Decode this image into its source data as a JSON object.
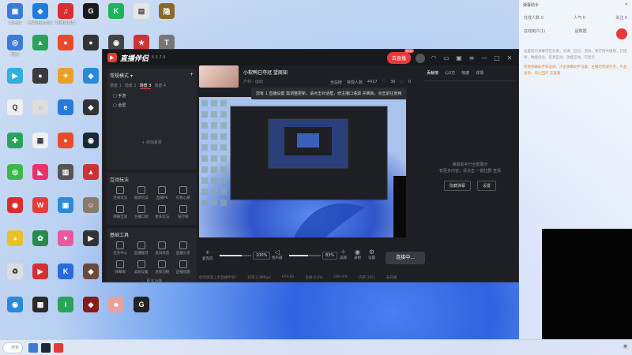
{
  "desktop": {
    "icons": [
      {
        "label": "此电脑",
        "color": "#3b7bd8",
        "glyph": "▣"
      },
      {
        "label": "腾讯电脑管家",
        "color": "#1f7ddd",
        "glyph": "◆"
      },
      {
        "label": "网易云音乐",
        "color": "#d62f2f",
        "glyph": "♫"
      },
      {
        "label": "GG",
        "color": "#1a1a1a",
        "glyph": "G"
      },
      {
        "label": "KOOK",
        "color": "#1fb45c",
        "glyph": "K"
      },
      {
        "label": "",
        "color": "#e6e6e6",
        "glyph": "▤"
      },
      {
        "label": "",
        "color": "#8a6a2a",
        "glyph": "隐"
      },
      {
        "label": "网络",
        "color": "#3b7bd8",
        "glyph": "◎"
      },
      {
        "label": "",
        "color": "#2aa35a",
        "glyph": "▲"
      },
      {
        "label": "",
        "color": "#e84a2a",
        "glyph": "●"
      },
      {
        "label": "",
        "color": "#333",
        "glyph": "●"
      },
      {
        "label": "",
        "color": "#3a3a3a",
        "glyph": "▲"
      },
      {
        "label": "",
        "color": "#c33",
        "glyph": "★"
      },
      {
        "label": "",
        "color": "#777",
        "glyph": "T"
      }
    ]
  },
  "app": {
    "title": "直播伴侣",
    "version": "6.5.7.4",
    "live_button": "去直播",
    "live_badge": "new",
    "left": {
      "mode": "常规模式",
      "mode_icon": "chevron-down",
      "add_scene": "+",
      "scene_tabs": [
        "场景 1",
        "场景 2",
        "场景 3",
        "场景 4"
      ],
      "active_scene": 2,
      "sources": [
        "手游",
        "全屏"
      ],
      "add_source": "+ 添加素材",
      "interact_title": "互动玩法",
      "interact_items": [
        "连线玩法",
        "福袋玩法",
        "直播PK",
        "礼物心愿",
        "弹幕互动",
        "主播口袋",
        "更多玩法",
        "排行榜"
      ],
      "tools_title": "基础工具",
      "tools_items": [
        "任务中心",
        "直播推荐",
        "道具商店",
        "直播分享",
        "弹幕库",
        "美颜设置",
        "场景切换",
        "直播答题"
      ],
      "more": "更多功能"
    },
    "center": {
      "stream_title": "小软鸭已夺冠 望周知",
      "stream_sub": "户外 · 运动",
      "stats": [
        "全站榜",
        "常规人数",
        "4417",
        "36",
        "0"
      ],
      "tooltip": "您有 1 直播设置 需调整更新，请点击对话框，修主播口语源 并刷新，点击前往使用",
      "mic_label": "麦克风",
      "mic_pct": "100%",
      "mic_fill": 0.7,
      "speaker_label": "扬声器",
      "speaker_pct": "83%",
      "speaker_fill": 0.6,
      "beauty_label": "美颜",
      "record_label": "录制",
      "settings_label": "设置",
      "start_button": "连接中...",
      "status_left": "如何快速上手直播伴侣?",
      "status_items": [
        "码率:2.8Mbps",
        "FPS:60",
        "丢帧:0.0%",
        "CPU:4%",
        "内存:26%",
        "未开播"
      ]
    },
    "right": {
      "tabs": [
        "贡献榜",
        "心2万",
        "热度",
        "详情"
      ],
      "empty_line1": "弹幕助手已全部展示",
      "empty_line2": "有更多内容，请点击 一键拉群 查看",
      "btn_hide": "隐藏弹幕",
      "btn_settings": "设置"
    }
  },
  "assistant": {
    "title": "弹幕助手",
    "stats": [
      {
        "label": "在线人数",
        "value": "0"
      },
      {
        "label": "人气",
        "value": "0"
      },
      {
        "label": "关注",
        "value": "0"
      }
    ],
    "row2": [
      "在线用户(1)",
      "话数据"
    ],
    "grey_text": "设置提示弹幕可在对讲，对讲、红包、道具、和打榜中展现，打招呼、数据优化、信息互动、功能互动、可显示",
    "orange_text": "新增弹幕助手和选择，点击弹幕助手设置，主播可完成任务，产品名称：风之回声 去查看"
  },
  "taskbar": {
    "search_placeholder": "搜索",
    "tray": "英"
  },
  "colors": {
    "accent": "#e83a3a",
    "window_bg": "#1e1f24"
  }
}
